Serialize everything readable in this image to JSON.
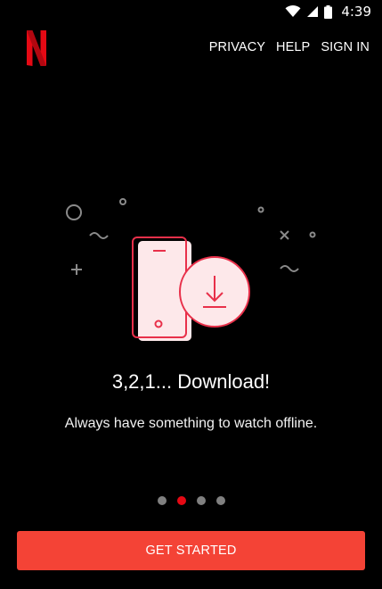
{
  "status_bar": {
    "time": "4:39",
    "icons": [
      "wifi-icon",
      "cell-signal-icon",
      "battery-icon"
    ]
  },
  "header": {
    "logo_icon": "netflix-n-logo",
    "nav": [
      {
        "label": "PRIVACY"
      },
      {
        "label": "HELP"
      },
      {
        "label": "SIGN IN"
      }
    ]
  },
  "slide": {
    "illustration_icon": "phone-download-icon",
    "title": "3,2,1... Download!",
    "subtitle": "Always have something to watch offline."
  },
  "pager": {
    "count": 4,
    "active_index": 1
  },
  "cta": {
    "label": "GET STARTED"
  },
  "colors": {
    "background": "#000000",
    "brand_red": "#e50914",
    "cta_red": "#f44336",
    "illustration_fill": "#fde8ea",
    "illustration_stroke": "#e8304a",
    "decor_gray": "#8a8a8a"
  }
}
